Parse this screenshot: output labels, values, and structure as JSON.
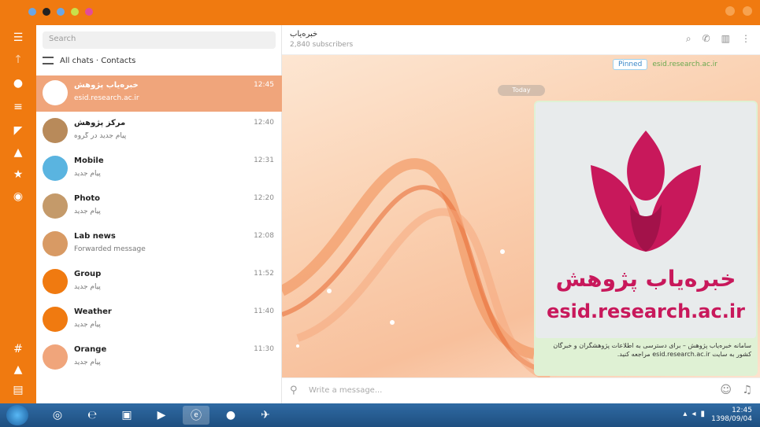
{
  "colors": {
    "accent": "#f07a10",
    "active_item": "#f0a57b",
    "brand_pink": "#c8185b"
  },
  "titlebar": {
    "dots": [
      "#6aa6e6",
      "#222222",
      "#6aa6e6",
      "#c9e04a",
      "#e24c9a"
    ]
  },
  "rail": {
    "icons": [
      "menu-icon",
      "arrow-icon",
      "user-icon",
      "users-icon",
      "megaphone-icon",
      "bot-icon",
      "star-icon",
      "telegram-icon",
      "hash-icon",
      "archive-icon",
      "folder-icon"
    ]
  },
  "list": {
    "search_placeholder": "Search",
    "header_label": "All chats · Contacts",
    "items": [
      {
        "name": "خبره‌یاب پژوهش",
        "time": "12:45",
        "preview": "esid.research.ac.ir",
        "avatar": "#ffffff",
        "active": true
      },
      {
        "name": "مرکز پژوهش",
        "time": "12:40",
        "preview": "پیام جدید در گروه",
        "avatar": "#b88a5a"
      },
      {
        "name": "Mobile",
        "time": "12:31",
        "preview": "پیام جدید",
        "avatar": "#5ab4e0"
      },
      {
        "name": "Photo",
        "time": "12:20",
        "preview": "پیام جدید",
        "avatar": "#c49a6a"
      },
      {
        "name": "Lab news",
        "time": "12:08",
        "preview": "Forwarded message",
        "avatar": "#d89a64"
      },
      {
        "name": "Group",
        "time": "11:52",
        "preview": "پیام جدید",
        "avatar": "#f07a10"
      },
      {
        "name": "Weather",
        "time": "11:40",
        "preview": "پیام جدید",
        "avatar": "#f07a10"
      },
      {
        "name": "Orange",
        "time": "11:30",
        "preview": "پیام جدید",
        "avatar": "#f0a57b"
      }
    ]
  },
  "chat": {
    "title": "خبره‌یاب",
    "subtitle": "2,840 subscribers",
    "header_icons": [
      "search-icon",
      "phone-icon",
      "sidebar-icon",
      "more-icon"
    ],
    "pinned_tag": "Pinned",
    "pinned_text": "esid.research.ac.ir",
    "date_chip": "Today",
    "image_persian": "خبره‌یاب پژوهش",
    "image_site": "esid.research.ac.ir",
    "caption": "سامانه خبره‌یاب پژوهش – برای دسترسی به اطلاعات پژوهشگران و خبرگان کشور به سایت esid.research.ac.ir مراجعه کنید.",
    "input_placeholder": "Write a message..."
  },
  "taskbar": {
    "apps": [
      "chrome-icon",
      "ie-icon",
      "folder-icon",
      "media-icon",
      "tools-icon",
      "edge-icon",
      "firefox-icon",
      "telegram-icon"
    ],
    "time": "12:45",
    "date": "1398/09/04"
  }
}
